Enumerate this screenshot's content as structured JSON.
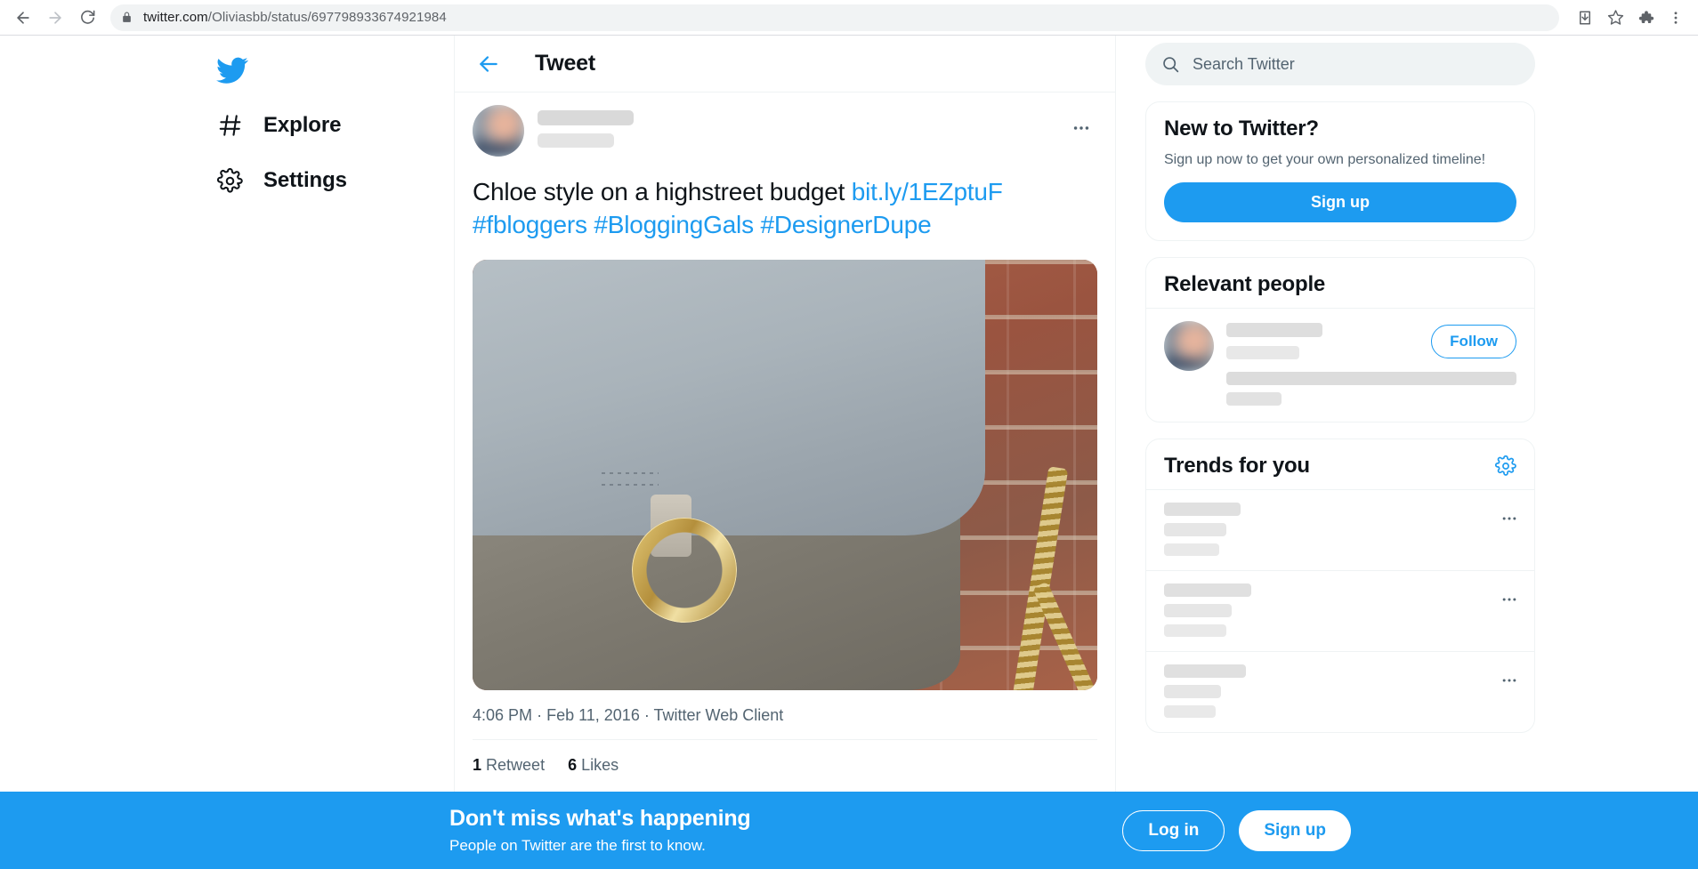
{
  "browser": {
    "back_icon": "back-arrow-icon",
    "forward_icon": "forward-arrow-icon",
    "reload_icon": "reload-icon",
    "lock_icon": "lock-icon",
    "url_host": "twitter.com",
    "url_path": "/Oliviasbb/status/697798933674921984",
    "url_full": "twitter.com/Oliviasbb/status/697798933674921984",
    "install_icon": "install-app-icon",
    "bookmark_icon": "star-icon",
    "extensions_icon": "puzzle-piece-icon",
    "menu_icon": "three-dot-menu-icon"
  },
  "sidebar": {
    "logo_icon": "twitter-bird-logo",
    "items": [
      {
        "label": "Explore",
        "icon": "hashtag-icon"
      },
      {
        "label": "Settings",
        "icon": "gear-icon"
      }
    ]
  },
  "tweet_header": {
    "back_icon": "back-arrow-icon",
    "title": "Tweet"
  },
  "tweet": {
    "more_icon": "more-options-icon",
    "avatar": "author-avatar",
    "text_plain": "Chloe style on a highstreet budget ",
    "link": "bit.ly/1EZptuF",
    "hashtags": [
      "#fbloggers",
      "#BloggingGals",
      "#DesignerDupe"
    ],
    "media_alt": "grey-suede-handbag-photo",
    "time": "4:06 PM",
    "date": "Feb 11, 2016",
    "client": "Twitter Web Client",
    "meta_separator": "·",
    "retweet_count": "1",
    "retweet_label": "Retweet",
    "like_count": "6",
    "like_label": "Likes"
  },
  "search": {
    "icon": "search-icon",
    "placeholder": "Search Twitter",
    "value": ""
  },
  "new_to_twitter": {
    "title": "New to Twitter?",
    "subtitle": "Sign up now to get your own personalized timeline!",
    "signup_label": "Sign up"
  },
  "relevant_people": {
    "title": "Relevant people",
    "follow_label": "Follow",
    "avatar": "relevant-person-avatar"
  },
  "trends": {
    "title": "Trends for you",
    "settings_icon": "gear-icon",
    "items": [
      {
        "more_icon": "more-options-icon"
      },
      {
        "more_icon": "more-options-icon"
      },
      {
        "more_icon": "more-options-icon"
      }
    ]
  },
  "bottom_banner": {
    "title": "Don't miss what's happening",
    "subtitle": "People on Twitter are the first to know.",
    "login_label": "Log in",
    "signup_label": "Sign up"
  },
  "colors": {
    "twitter_blue": "#1d9bf0",
    "text_primary": "#0f1419",
    "text_secondary": "#536471",
    "border": "#eff3f4",
    "search_bg": "#eff3f4"
  }
}
